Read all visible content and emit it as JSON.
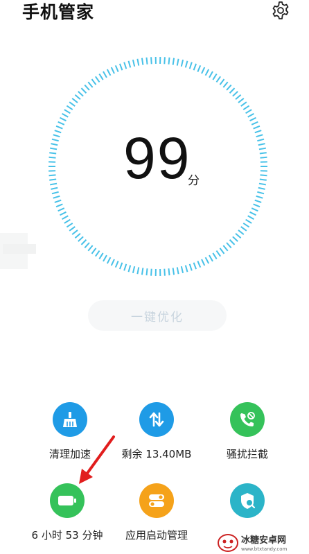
{
  "header": {
    "title": "手机管家",
    "settings_icon": "gear-icon"
  },
  "score": {
    "value": "99",
    "unit": "分",
    "ring_color": "#47c1e8"
  },
  "optimize": {
    "label": "一键优化"
  },
  "features": [
    {
      "label": "清理加速",
      "icon": "broom-icon",
      "color": "#1f9be6"
    },
    {
      "label": "剩余 13.40MB",
      "icon": "data-arrows-icon",
      "color": "#1f9be6"
    },
    {
      "label": "骚扰拦截",
      "icon": "phone-block-icon",
      "color": "#35c25a"
    },
    {
      "label": "6 小时 53 分钟",
      "icon": "battery-icon",
      "color": "#35c25a"
    },
    {
      "label": "应用启动管理",
      "icon": "toggle-icon",
      "color": "#f5a21a"
    },
    {
      "label": "",
      "icon": "shield-search-icon",
      "color": "#2bb4c8"
    }
  ],
  "watermark": {
    "name": "冰糖安卓网",
    "url": "www.btxtandy.com"
  }
}
